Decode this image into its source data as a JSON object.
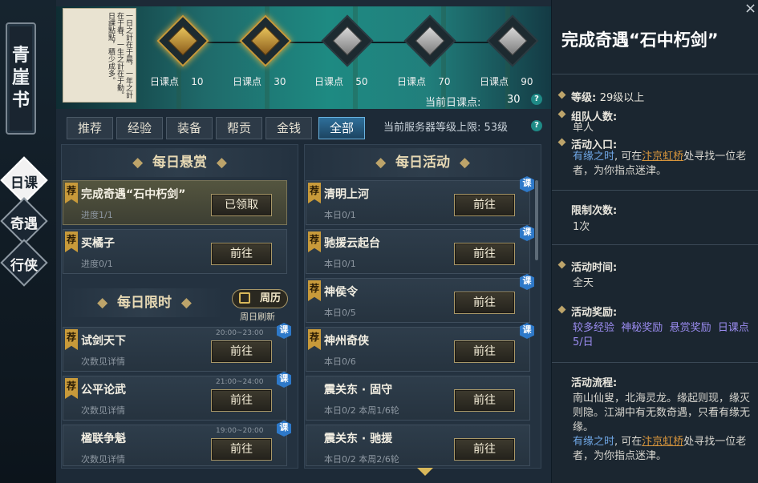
{
  "left_nav": {
    "book_title": [
      "青",
      "崖",
      "书"
    ],
    "items": [
      {
        "label": "日课",
        "active": true
      },
      {
        "label": "奇遇",
        "active": false
      },
      {
        "label": "行侠",
        "active": false
      }
    ]
  },
  "banner": {
    "scroll_text": "一日之計在于晨，一年之計在于春，一生之計在于勤。日課點點，積少成多。",
    "milestones": [
      {
        "label": "日课点",
        "value": "10",
        "state": "gold"
      },
      {
        "label": "日课点",
        "value": "30",
        "state": "gold"
      },
      {
        "label": "日课点",
        "value": "50",
        "state": "silver"
      },
      {
        "label": "日课点",
        "value": "70",
        "state": "silver"
      },
      {
        "label": "日课点",
        "value": "90",
        "state": "silver"
      }
    ],
    "current_label": "当前日课点:",
    "current_value": "30"
  },
  "tabs": [
    "推荐",
    "经验",
    "装备",
    "帮贡",
    "金钱",
    "全部"
  ],
  "active_tab": "全部",
  "server_level": "当前服务器等级上限: 53级",
  "left_col": {
    "daily_bounty_title": "每日悬赏",
    "daily_bounty": [
      {
        "name": "完成奇遇“石中朽剑”",
        "sub": "进度1/1",
        "btn": "已领取",
        "rec": "荐",
        "hl": true
      },
      {
        "name": "买橘子",
        "sub": "进度0/1",
        "btn": "前往",
        "rec": "荐",
        "hl": false
      }
    ],
    "daily_limited_title": "每日限时",
    "weekly_calendar": "周历",
    "weekly_refresh": "周日刷新",
    "daily_limited": [
      {
        "name": "试剑天下",
        "sub": "次数见详情",
        "time": "20:00~23:00",
        "btn": "前往",
        "rec": "荐",
        "ke": "课"
      },
      {
        "name": "公平论武",
        "sub": "次数见详情",
        "time": "21:00~24:00",
        "btn": "前往",
        "rec": "荐",
        "ke": "课"
      },
      {
        "name": "楹联争魁",
        "sub": "次数见详情",
        "time": "19:00~20:00",
        "btn": "前往",
        "rec": "",
        "ke": "课"
      }
    ]
  },
  "right_col": {
    "title": "每日活动",
    "items": [
      {
        "name": "清明上河",
        "sub": "本日0/1",
        "btn": "前往",
        "rec": "荐",
        "ke": "课"
      },
      {
        "name": "驰援云起台",
        "sub": "本日0/1",
        "btn": "前往",
        "rec": "荐",
        "ke": "课"
      },
      {
        "name": "神侯令",
        "sub": "本日0/5",
        "btn": "前往",
        "rec": "荐",
        "ke": "课"
      },
      {
        "name": "神州奇侠",
        "sub": "本日0/6",
        "btn": "前往",
        "rec": "荐",
        "ke": "课"
      },
      {
        "name": "震关东 · 固守",
        "sub": "本日0/2  本周1/6轮",
        "btn": "前往",
        "rec": "",
        "ke": ""
      },
      {
        "name": "震关东 · 驰援",
        "sub": "本日0/2  本周2/6轮",
        "btn": "前往",
        "rec": "",
        "ke": ""
      }
    ]
  },
  "detail": {
    "title": "完成奇遇“石中朽剑”",
    "level_key": "等级:",
    "level_val": "29级以上",
    "team_key": "组队人数:",
    "team_val": "单人",
    "entry_key": "活动入口:",
    "entry_a": "有缘之时",
    "entry_b": ", 可在",
    "entry_place": "汴京虹桥",
    "entry_c": "处寻找一位老者，为你指点迷津。",
    "limit_key": "限制次数:",
    "limit_val": "1次",
    "time_key": "活动时间:",
    "time_val": "全天",
    "reward_key": "活动奖励:",
    "rewards": [
      "较多经验",
      "神秘奖励",
      "悬赏奖励",
      "日课点5/日"
    ],
    "flow_key": "活动流程:",
    "flow_text": "南山仙叟，北海灵龙。缘起则现，缘灭则隐。江湖中有无数奇遇，只看有缘无缘。",
    "flow_a": "有缘之时",
    "flow_b": ", 可在",
    "flow_place": "汴京虹桥",
    "flow_c": "处寻找一位老者，为你指点迷津。",
    "close": "×"
  },
  "colors": {
    "accent_gold": "#c89a3a",
    "link_blue": "#6fa7e6",
    "link_orange": "#d9963c",
    "reward_purple": "#9b8cf0"
  }
}
